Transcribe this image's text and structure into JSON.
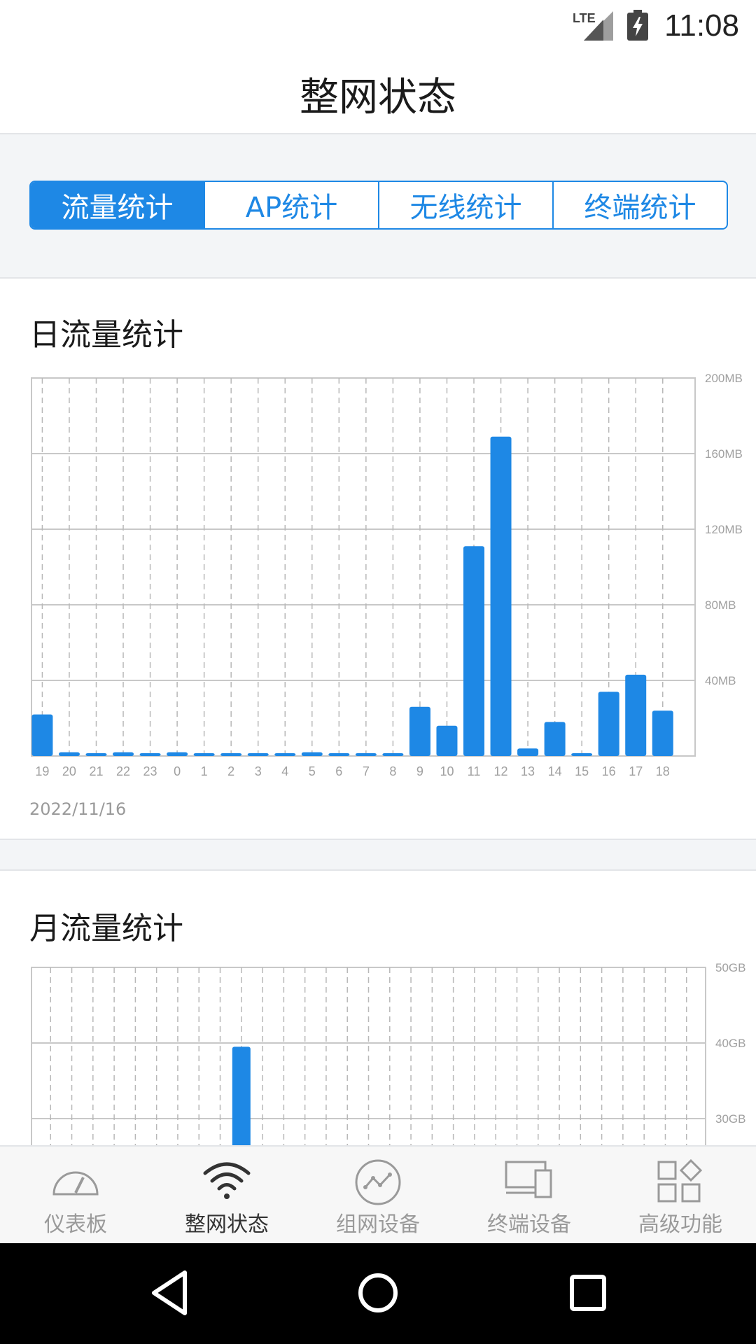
{
  "status_bar": {
    "network": "LTE",
    "time": "11:08"
  },
  "header": {
    "title": "整网状态"
  },
  "tabs": [
    {
      "label": "流量统计",
      "active": true
    },
    {
      "label": "AP统计",
      "active": false
    },
    {
      "label": "无线统计",
      "active": false
    },
    {
      "label": "终端统计",
      "active": false
    }
  ],
  "daily": {
    "title": "日流量统计",
    "date": "2022/11/16",
    "chart_data": {
      "type": "bar",
      "categories": [
        "19",
        "20",
        "21",
        "22",
        "23",
        "0",
        "1",
        "2",
        "3",
        "4",
        "5",
        "6",
        "7",
        "8",
        "9",
        "10",
        "11",
        "12",
        "13",
        "14",
        "15",
        "16",
        "17",
        "18"
      ],
      "values": [
        22,
        2,
        1.5,
        2,
        1.5,
        2,
        1.5,
        1.5,
        1.5,
        1.5,
        2,
        1.5,
        1.5,
        1.5,
        26,
        16,
        111,
        169,
        4,
        18,
        0.5,
        34,
        43,
        24
      ],
      "ylim": [
        0,
        200
      ],
      "y_ticks": [
        "200MB",
        "160MB",
        "120MB",
        "80MB",
        "40MB"
      ],
      "y_tick_values": [
        200,
        160,
        120,
        80,
        40
      ],
      "grid": true,
      "bar_color": "#1e88e5"
    }
  },
  "monthly": {
    "title": "月流量统计",
    "chart_data": {
      "type": "bar",
      "bar_count": 31,
      "visible_bars": [
        {
          "index": 9,
          "value": 39.5
        }
      ],
      "ylim": [
        0,
        50
      ],
      "y_ticks": [
        "50GB",
        "40GB",
        "30GB"
      ],
      "y_tick_values": [
        50,
        40,
        30
      ],
      "grid": true,
      "bar_color": "#1e88e5"
    }
  },
  "bottom_nav": [
    {
      "label": "仪表板",
      "icon": "gauge-icon",
      "active": false
    },
    {
      "label": "整网状态",
      "icon": "wifi-icon",
      "active": true
    },
    {
      "label": "组网设备",
      "icon": "network-device-icon",
      "active": false
    },
    {
      "label": "终端设备",
      "icon": "devices-icon",
      "active": false
    },
    {
      "label": "高级功能",
      "icon": "apps-icon",
      "active": false
    }
  ]
}
